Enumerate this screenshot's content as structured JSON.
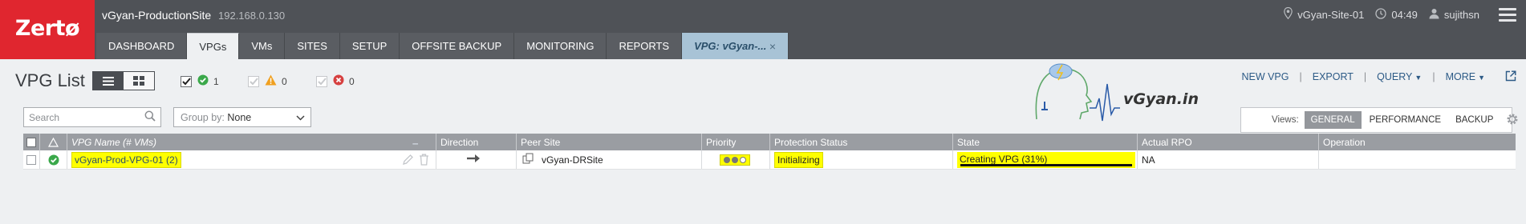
{
  "app": {
    "logo": "Zertø",
    "site_name": "vGyan-ProductionSite",
    "site_ip": "192.168.0.130"
  },
  "status": {
    "location": "vGyan-Site-01",
    "time": "04:49",
    "user": "sujithsn"
  },
  "tabs": [
    {
      "label": "DASHBOARD",
      "active": false
    },
    {
      "label": "VPGs",
      "active": true
    },
    {
      "label": "VMs",
      "active": false
    },
    {
      "label": "SITES",
      "active": false
    },
    {
      "label": "SETUP",
      "active": false
    },
    {
      "label": "OFFSITE BACKUP",
      "active": false
    },
    {
      "label": "MONITORING",
      "active": false
    },
    {
      "label": "REPORTS",
      "active": false
    }
  ],
  "vpg_tab": {
    "label": "VPG: vGyan-...",
    "close": "×"
  },
  "page": {
    "title": "VPG List"
  },
  "filters": {
    "ok_count": "1",
    "warning_count": "0",
    "error_count": "0"
  },
  "actions": {
    "new_vpg": "NEW VPG",
    "export": "EXPORT",
    "query": "QUERY",
    "more": "MORE"
  },
  "search": {
    "placeholder": "Search"
  },
  "groupby": {
    "label": "Group by:",
    "value": "None"
  },
  "views": {
    "label": "Views:",
    "general": "GENERAL",
    "performance": "PERFORMANCE",
    "backup": "BACKUP"
  },
  "watermark": {
    "text": "vGyan.in"
  },
  "table": {
    "headers": {
      "name": "VPG Name (# VMs)",
      "direction": "Direction",
      "peer_site": "Peer Site",
      "priority": "Priority",
      "protection_status": "Protection Status",
      "state": "State",
      "actual_rpo": "Actual RPO",
      "operation": "Operation"
    },
    "rows": [
      {
        "name": "vGyan-Prod-VPG-01 (2)",
        "direction": "→",
        "peer_site": "vGyan-DRSite",
        "priority": "Medium",
        "protection_status": "Initializing",
        "state": "Creating VPG (31%)",
        "state_progress": 0.31,
        "actual_rpo": "NA",
        "operation": ""
      }
    ]
  },
  "colors": {
    "brand": "#e0262f",
    "topbar": "#4f5257",
    "highlight": "#ffff00",
    "ok": "#3aa84a",
    "warning": "#f0a020",
    "error": "#d64040",
    "link": "#2c5a86"
  }
}
